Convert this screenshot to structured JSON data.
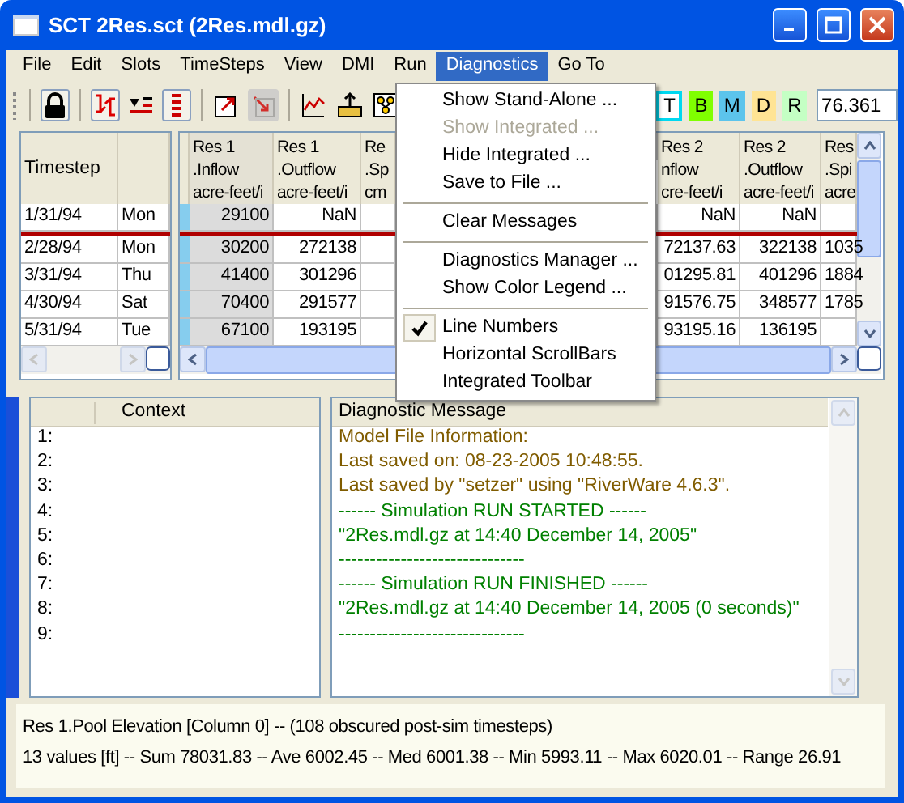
{
  "window": {
    "title": "SCT 2Res.sct (2Res.mdl.gz)"
  },
  "menu_bar": [
    {
      "label": "File",
      "selected": false
    },
    {
      "label": "Edit",
      "selected": false
    },
    {
      "label": "Slots",
      "selected": false
    },
    {
      "label": "TimeSteps",
      "selected": false
    },
    {
      "label": "View",
      "selected": false
    },
    {
      "label": "DMI",
      "selected": false
    },
    {
      "label": "Run",
      "selected": false
    },
    {
      "label": "Diagnostics",
      "selected": true
    },
    {
      "label": "Go To",
      "selected": false
    }
  ],
  "toolbar": {
    "buttons": [
      {
        "pressed": true,
        "disabled": false
      },
      {
        "pressed": true,
        "disabled": false
      },
      {
        "pressed": false,
        "disabled": false
      },
      {
        "pressed": true,
        "disabled": false
      },
      {
        "pressed": false,
        "disabled": false
      },
      {
        "pressed": false,
        "disabled": true
      },
      {
        "pressed": false,
        "disabled": false
      },
      {
        "pressed": false,
        "disabled": false
      },
      {
        "pressed": false,
        "disabled": false
      }
    ],
    "letter_buttons": [
      {
        "label": "T",
        "color": "#ffffff"
      },
      {
        "label": "B",
        "color": "#80ff00"
      },
      {
        "label": "M",
        "color": "#5cc4ec"
      },
      {
        "label": "D",
        "color": "#ffe494"
      },
      {
        "label": "R",
        "color": "#c4ffc4"
      }
    ],
    "value_field": "76.361"
  },
  "timestep_table": {
    "columns": [
      "Timestep"
    ],
    "rows": [
      [
        "1/31/94",
        "Mon"
      ],
      [
        "2/28/94",
        "Mon"
      ],
      [
        "3/31/94",
        "Thu"
      ],
      [
        "4/30/94",
        "Sat"
      ],
      [
        "5/31/94",
        "Tue"
      ]
    ]
  },
  "slot_table": {
    "columns": [
      {
        "header": [
          "Res 1",
          ".Inflow",
          "acre-feet/i"
        ],
        "selected": true
      },
      {
        "header": [
          "Res 1",
          ".Outflow",
          "acre-feet/i"
        ],
        "selected": false
      },
      {
        "header": [
          "Re",
          ".Sp",
          "cm"
        ],
        "selected": false
      },
      {
        "header": [
          "Res 2",
          "nflow",
          "cre-feet/i"
        ],
        "selected": false
      },
      {
        "header": [
          "Res 2",
          ".Outflow",
          "acre-feet/i"
        ],
        "selected": false
      },
      {
        "header": [
          "Res",
          ".Spi",
          "acre"
        ],
        "selected": false
      }
    ],
    "rows": [
      [
        "29100",
        "NaN",
        "",
        "NaN",
        "NaN",
        ""
      ],
      [
        "30200",
        "272138",
        "",
        "72137.63",
        "322138",
        "1035"
      ],
      [
        "41400",
        "301296",
        "",
        "01295.81",
        "401296",
        "1884"
      ],
      [
        "70400",
        "291577",
        "",
        "91576.75",
        "348577",
        "1785"
      ],
      [
        "67100",
        "193195",
        "",
        "93195.16",
        "136195",
        ""
      ]
    ]
  },
  "diagnostics_menu": [
    {
      "kind": "item",
      "label": "Show Stand-Alone ...",
      "disabled": false,
      "checked": false
    },
    {
      "kind": "item",
      "label": "Show Integrated ...",
      "disabled": true,
      "checked": false
    },
    {
      "kind": "item",
      "label": "Hide Integrated ...",
      "disabled": false,
      "checked": false
    },
    {
      "kind": "item",
      "label": "Save to File ...",
      "disabled": false,
      "checked": false
    },
    {
      "kind": "separator"
    },
    {
      "kind": "item",
      "label": "Clear Messages",
      "disabled": false,
      "checked": false
    },
    {
      "kind": "separator"
    },
    {
      "kind": "item",
      "label": "Diagnostics Manager ...",
      "disabled": false,
      "checked": false
    },
    {
      "kind": "item",
      "label": "Show Color Legend ...",
      "disabled": false,
      "checked": false
    },
    {
      "kind": "separator"
    },
    {
      "kind": "item",
      "label": "Line Numbers",
      "disabled": false,
      "checked": true
    },
    {
      "kind": "item",
      "label": "Horizontal ScrollBars",
      "disabled": false,
      "checked": false
    },
    {
      "kind": "item",
      "label": "Integrated Toolbar",
      "disabled": false,
      "checked": false
    }
  ],
  "context_pane": {
    "header": "Context",
    "lines": [
      "1:",
      "2:",
      "3:",
      "4:",
      "5:",
      "6:",
      "7:",
      "8:",
      "9:"
    ]
  },
  "message_pane": {
    "header": "Diagnostic Message",
    "messages": [
      {
        "text": "Model File Information:",
        "color": "#805c00"
      },
      {
        "text": "Last saved on: 08-23-2005 10:48:55.",
        "color": "#805c00"
      },
      {
        "text": "Last saved by \"setzer\" using \"RiverWare 4.6.3\".",
        "color": "#805c00"
      },
      {
        "text": "------ Simulation RUN STARTED ------",
        "color": "#008000"
      },
      {
        "text": "\"2Res.mdl.gz at 14:40 December 14, 2005\"",
        "color": "#008000"
      },
      {
        "text": "------------------------------",
        "color": "#008000"
      },
      {
        "text": "------ Simulation RUN FINISHED ------",
        "color": "#008000"
      },
      {
        "text": "\"2Res.mdl.gz at 14:40 December 14, 2005 (0 seconds)\"",
        "color": "#008000"
      },
      {
        "text": "------------------------------",
        "color": "#008000"
      }
    ]
  },
  "status_bar": [
    "Res 1.Pool Elevation [Column 0] -- (108 obscured post-sim timesteps)",
    "13 values [ft] -- Sum 78031.83 -- Ave 6002.45 -- Med 6001.38 -- Min 5993.11 -- Max 6020.01 -- Range 26.91"
  ]
}
